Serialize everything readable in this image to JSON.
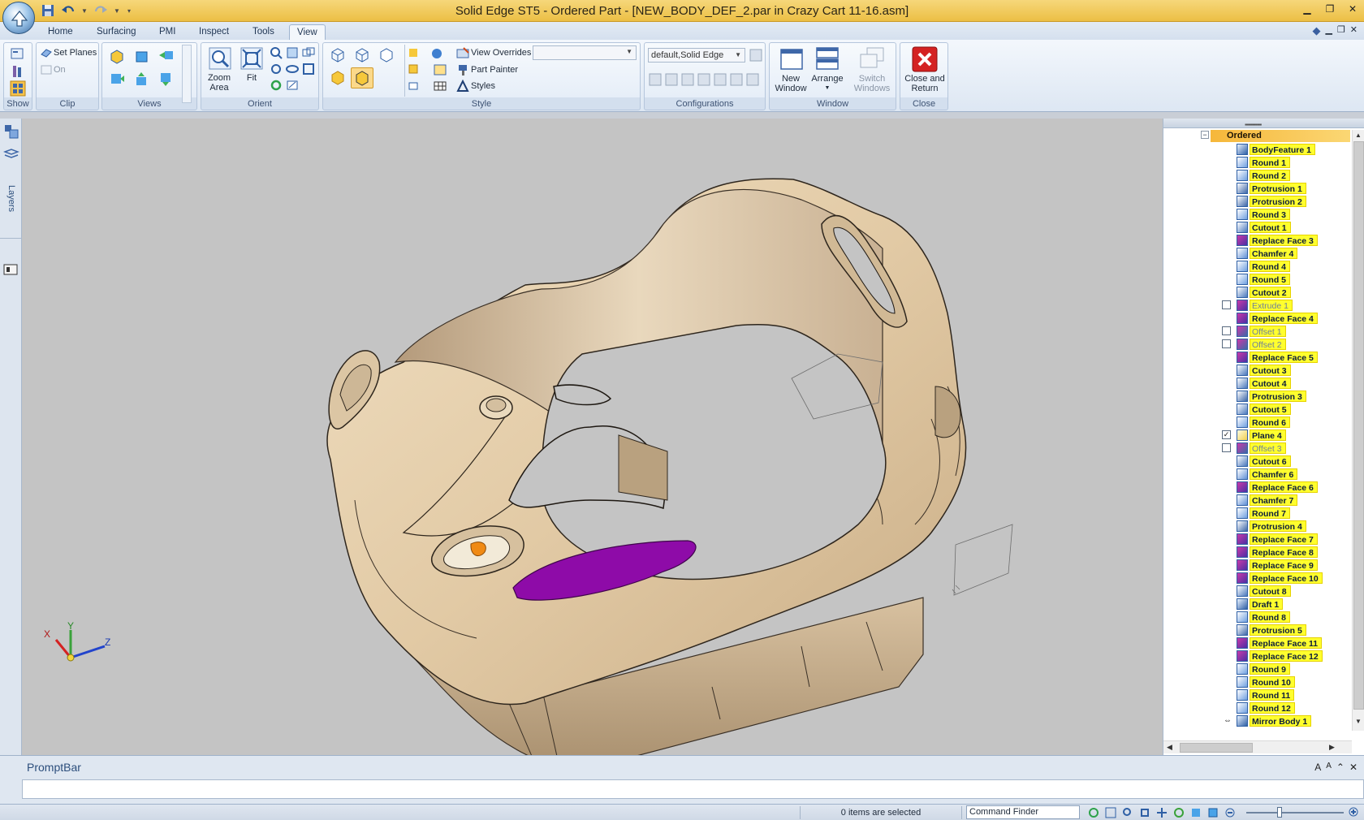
{
  "window": {
    "title": "Solid Edge ST5 - Ordered Part - [NEW_BODY_DEF_2.par in Crazy Cart 11-16.asm]",
    "controls": [
      "minimize",
      "restore",
      "close"
    ]
  },
  "quick_access": [
    "save-icon",
    "undo-icon",
    "redo-icon",
    "customize-icon"
  ],
  "tabs": [
    {
      "label": "Home",
      "active": false
    },
    {
      "label": "Surfacing",
      "active": false
    },
    {
      "label": "PMI",
      "active": false
    },
    {
      "label": "Inspect",
      "active": false
    },
    {
      "label": "Tools",
      "active": false
    },
    {
      "label": "View",
      "active": true
    }
  ],
  "ribbon": {
    "groups": {
      "show": "Show",
      "clip": "Clip",
      "views": "Views",
      "orient": "Orient",
      "style": "Style",
      "configurations": "Configurations",
      "window": "Window",
      "close": "Close"
    },
    "clip": {
      "set_planes": "Set Planes",
      "on": "On"
    },
    "orient": {
      "zoom_area": "Zoom\nArea",
      "fit": "Fit"
    },
    "style": {
      "view_overrides": "View Overrides",
      "part_painter": "Part Painter",
      "styles": "Styles",
      "override_value": ""
    },
    "configurations": {
      "selected": "default,Solid Edge"
    },
    "window": {
      "new_window": "New\nWindow",
      "arrange": "Arrange",
      "switch_windows": "Switch\nWindows"
    },
    "close": {
      "close_and_return": "Close and\nReturn"
    }
  },
  "leftbar": {
    "layers_label": "Layers"
  },
  "pathfinder": {
    "root": "Ordered",
    "features": [
      {
        "name": "BodyFeature 1",
        "icon": "body-feature-icon",
        "checkbox": null
      },
      {
        "name": "Round 1",
        "icon": "round-icon",
        "checkbox": null
      },
      {
        "name": "Round 2",
        "icon": "round-icon",
        "checkbox": null
      },
      {
        "name": "Protrusion 1",
        "icon": "protrusion-icon",
        "checkbox": null
      },
      {
        "name": "Protrusion 2",
        "icon": "protrusion-icon",
        "checkbox": null
      },
      {
        "name": "Round 3",
        "icon": "round-icon",
        "checkbox": null
      },
      {
        "name": "Cutout 1",
        "icon": "cutout-icon",
        "checkbox": null
      },
      {
        "name": "Replace Face 3",
        "icon": "replace-face-icon",
        "checkbox": null
      },
      {
        "name": "Chamfer 4",
        "icon": "chamfer-icon",
        "checkbox": null
      },
      {
        "name": "Round 4",
        "icon": "round-icon",
        "checkbox": null
      },
      {
        "name": "Round 5",
        "icon": "round-icon",
        "checkbox": null
      },
      {
        "name": "Cutout 2",
        "icon": "cutout-icon",
        "checkbox": null
      },
      {
        "name": "Extrude 1",
        "icon": "extrude-icon",
        "checkbox": false,
        "suppressed": true
      },
      {
        "name": "Replace Face 4",
        "icon": "replace-face-icon",
        "checkbox": null
      },
      {
        "name": "Offset 1",
        "icon": "offset-icon",
        "checkbox": false,
        "suppressed": true
      },
      {
        "name": "Offset 2",
        "icon": "offset-icon",
        "checkbox": false,
        "suppressed": true
      },
      {
        "name": "Replace Face 5",
        "icon": "replace-face-icon",
        "checkbox": null
      },
      {
        "name": "Cutout 3",
        "icon": "cutout-icon",
        "checkbox": null
      },
      {
        "name": "Cutout 4",
        "icon": "cutout-icon",
        "checkbox": null
      },
      {
        "name": "Protrusion 3",
        "icon": "protrusion-icon",
        "checkbox": null
      },
      {
        "name": "Cutout 5",
        "icon": "cutout-icon",
        "checkbox": null
      },
      {
        "name": "Round 6",
        "icon": "round-icon",
        "checkbox": null
      },
      {
        "name": "Plane 4",
        "icon": "plane-icon",
        "checkbox": true
      },
      {
        "name": "Offset 3",
        "icon": "offset-icon",
        "checkbox": false,
        "suppressed": true
      },
      {
        "name": "Cutout 6",
        "icon": "cutout-icon",
        "checkbox": null
      },
      {
        "name": "Chamfer 6",
        "icon": "chamfer-icon",
        "checkbox": null
      },
      {
        "name": "Replace Face 6",
        "icon": "replace-face-icon",
        "checkbox": null
      },
      {
        "name": "Chamfer 7",
        "icon": "chamfer-icon",
        "checkbox": null
      },
      {
        "name": "Round 7",
        "icon": "round-icon",
        "checkbox": null
      },
      {
        "name": "Protrusion 4",
        "icon": "protrusion-icon",
        "checkbox": null
      },
      {
        "name": "Replace Face 7",
        "icon": "replace-face-icon",
        "checkbox": null
      },
      {
        "name": "Replace Face 8",
        "icon": "replace-face-icon",
        "checkbox": null
      },
      {
        "name": "Replace Face 9",
        "icon": "replace-face-icon",
        "checkbox": null
      },
      {
        "name": "Replace Face 10",
        "icon": "replace-face-icon",
        "checkbox": null
      },
      {
        "name": "Cutout 8",
        "icon": "cutout-icon",
        "checkbox": null
      },
      {
        "name": "Draft 1",
        "icon": "draft-icon",
        "checkbox": null
      },
      {
        "name": "Round 8",
        "icon": "round-icon",
        "checkbox": null
      },
      {
        "name": "Protrusion 5",
        "icon": "protrusion-icon",
        "checkbox": null
      },
      {
        "name": "Replace Face 11",
        "icon": "replace-face-icon",
        "checkbox": null
      },
      {
        "name": "Replace Face 12",
        "icon": "replace-face-icon",
        "checkbox": null
      },
      {
        "name": "Round 9",
        "icon": "round-icon",
        "checkbox": null
      },
      {
        "name": "Round 10",
        "icon": "round-icon",
        "checkbox": null
      },
      {
        "name": "Round 11",
        "icon": "round-icon",
        "checkbox": null
      },
      {
        "name": "Round 12",
        "icon": "round-icon",
        "checkbox": null
      },
      {
        "name": "Mirror Body 1",
        "icon": "mirror-body-icon",
        "checkbox": null,
        "current": true
      }
    ]
  },
  "viewport": {
    "triad": {
      "x": "X",
      "y": "Y",
      "z": "Z"
    },
    "colors": {
      "background": "#c4c4c4",
      "part": "#e3cca9",
      "highlight": "#8e0ba8",
      "accent": "#f08a14"
    }
  },
  "promptbar": {
    "title": "PromptBar",
    "text": ""
  },
  "status": {
    "selection": "0 items are selected",
    "command_finder": "Command Finder"
  }
}
